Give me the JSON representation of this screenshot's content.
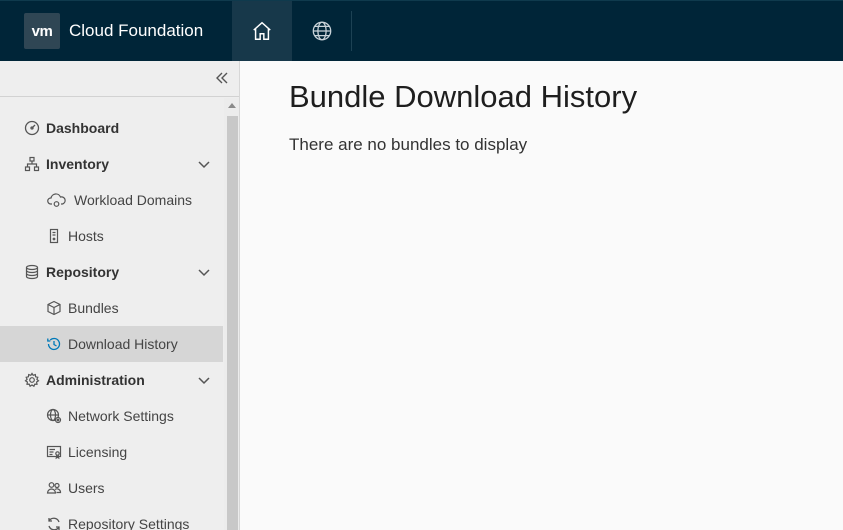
{
  "header": {
    "logo_text": "vm",
    "title": "Cloud Foundation",
    "nav": [
      {
        "icon": "home-icon",
        "active": true
      },
      {
        "icon": "globe-icon",
        "active": false
      }
    ]
  },
  "sidebar": {
    "items": [
      {
        "label": "Dashboard",
        "icon": "dashboard-icon",
        "level": 0
      },
      {
        "label": "Inventory",
        "icon": "inventory-icon",
        "level": 0,
        "expanded": true
      },
      {
        "label": "Workload Domains",
        "icon": "cloud-icon",
        "level": 1
      },
      {
        "label": "Hosts",
        "icon": "host-icon",
        "level": 1
      },
      {
        "label": "Repository",
        "icon": "database-icon",
        "level": 0,
        "expanded": true
      },
      {
        "label": "Bundles",
        "icon": "bundle-icon",
        "level": 1
      },
      {
        "label": "Download History",
        "icon": "history-icon",
        "level": 1,
        "active": true
      },
      {
        "label": "Administration",
        "icon": "gear-icon",
        "level": 0,
        "expanded": true
      },
      {
        "label": "Network Settings",
        "icon": "network-settings-icon",
        "level": 1
      },
      {
        "label": "Licensing",
        "icon": "license-icon",
        "level": 1
      },
      {
        "label": "Users",
        "icon": "users-icon",
        "level": 1
      },
      {
        "label": "Repository Settings",
        "icon": "refresh-icon",
        "level": 1
      }
    ]
  },
  "main": {
    "title": "Bundle Download History",
    "empty_message": "There are no bundles to display"
  },
  "colors": {
    "header_bg": "#002538",
    "sidebar_bg": "#eeeeee",
    "active_item_bg": "#d6d6d6",
    "history_icon": "#0079b8"
  }
}
